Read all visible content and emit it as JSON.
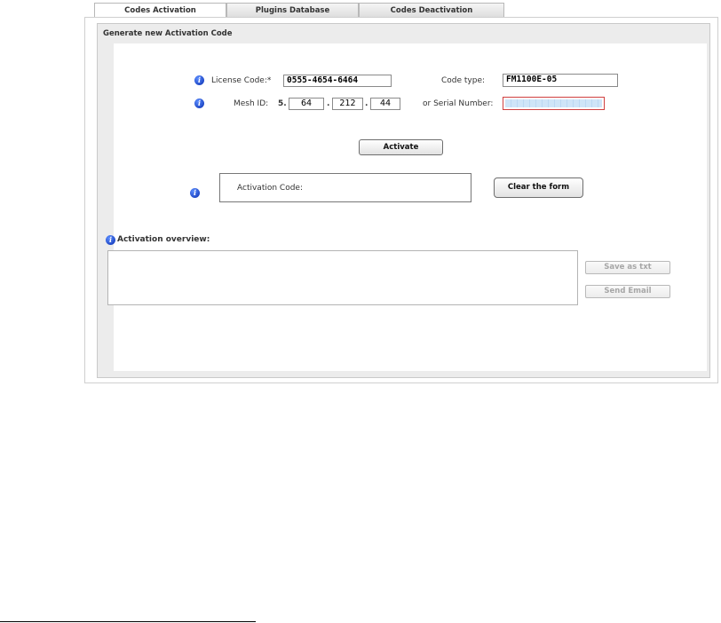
{
  "tabs": [
    {
      "label": "Codes Activation",
      "active": true
    },
    {
      "label": "Plugins Database",
      "active": false
    },
    {
      "label": "Codes Deactivation",
      "active": false
    }
  ],
  "panel": {
    "title": "Generate new Activation Code"
  },
  "form": {
    "license_code_label": "License Code:*",
    "license_code_value": "0555-4654-6464",
    "code_type_label": "Code type:",
    "code_type_value": "FM1100E-05",
    "mesh_id_label": "Mesh ID:",
    "mesh_id_prefix": "5.",
    "mesh_id_parts": [
      "64",
      "212",
      "44"
    ],
    "mesh_sep": ".",
    "serial_label": "or Serial Number:",
    "serial_value": "",
    "activate_label": "Activate",
    "activation_code_label": "Activation Code:",
    "clear_label": "Clear the form"
  },
  "overview": {
    "label": "Activation overview:",
    "save_label": "Save as txt",
    "email_label": "Send Email"
  },
  "icons": {
    "info": "info-icon"
  }
}
